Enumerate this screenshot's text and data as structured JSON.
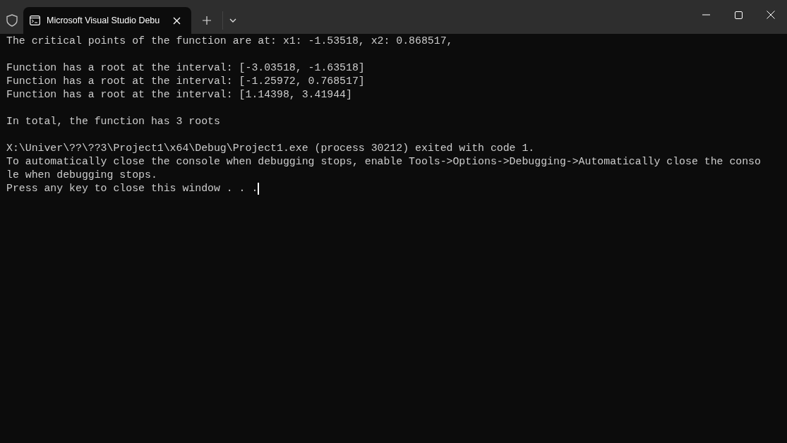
{
  "tab": {
    "title": "Microsoft Visual Studio Debu",
    "selected": true
  },
  "console": {
    "lines": [
      {
        "kind": "text",
        "text": "The critical points of the function are at: x1: -1.53518, x2: 0.868517,"
      },
      {
        "kind": "blank"
      },
      {
        "kind": "text",
        "text": "Function has a root at the interval: [-3.03518, -1.63518]"
      },
      {
        "kind": "text",
        "text": "Function has a root at the interval: [-1.25972, 0.768517]"
      },
      {
        "kind": "text",
        "text": "Function has a root at the interval: [1.14398, 3.41944]"
      },
      {
        "kind": "blank"
      },
      {
        "kind": "text",
        "text": "In total, the function has 3 roots"
      },
      {
        "kind": "blank"
      },
      {
        "kind": "text",
        "text": "X:\\Univer\\??\\??3\\Project1\\x64\\Debug\\Project1.exe (process 30212) exited with code 1."
      },
      {
        "kind": "text",
        "text": "To automatically close the console when debugging stops, enable Tools->Options->Debugging->Automatically close the conso"
      },
      {
        "kind": "text",
        "text": "le when debugging stops."
      },
      {
        "kind": "text",
        "text": "Press any key to close this window . . ."
      }
    ],
    "cursor": true
  }
}
